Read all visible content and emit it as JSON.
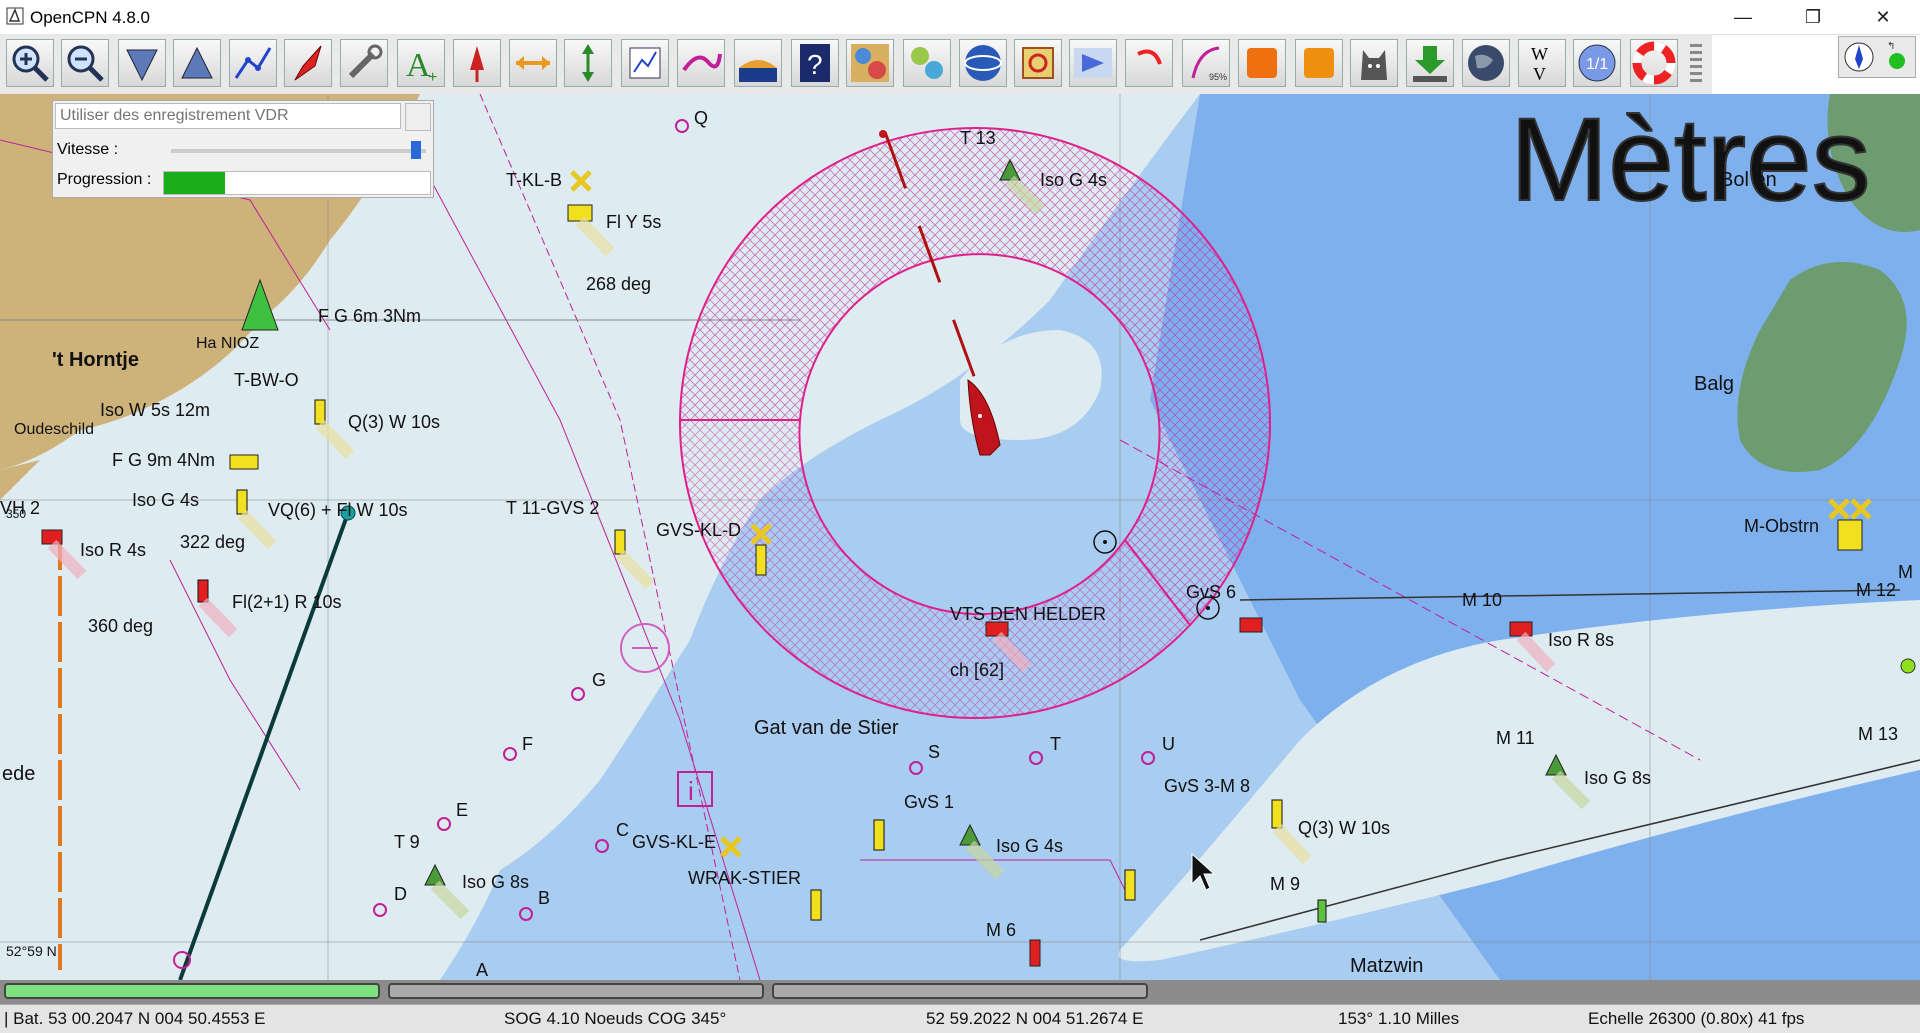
{
  "window": {
    "title": "OpenCPN 4.8.0",
    "minimize": "—",
    "maximize": "❐",
    "close": "✕"
  },
  "toolbar": {
    "tools": [
      {
        "name": "zoom-in",
        "icon": "zoom-in-icon"
      },
      {
        "name": "zoom-out",
        "icon": "zoom-out-icon"
      },
      {
        "name": "scale-down",
        "icon": "scale-down-icon"
      },
      {
        "name": "scale-up",
        "icon": "scale-up-icon"
      },
      {
        "name": "route",
        "icon": "route-icon"
      },
      {
        "name": "auto-follow",
        "icon": "ship-icon"
      },
      {
        "name": "settings",
        "icon": "wrench-icon"
      },
      {
        "name": "text",
        "icon": "text-icon"
      },
      {
        "name": "current",
        "icon": "current-icon"
      },
      {
        "name": "tide",
        "icon": "tide-icon"
      },
      {
        "name": "measure",
        "icon": "measure-icon"
      },
      {
        "name": "route-manager",
        "icon": "route-manager-icon"
      },
      {
        "name": "track",
        "icon": "track-icon"
      },
      {
        "name": "color-scheme",
        "icon": "color-scheme-icon"
      },
      {
        "name": "help",
        "icon": "help-icon"
      },
      {
        "name": "grib",
        "icon": "grib-icon"
      },
      {
        "name": "dashboard",
        "icon": "dashboard-icon"
      },
      {
        "name": "google-earth",
        "icon": "globe-icon"
      },
      {
        "name": "logbook",
        "icon": "logbook-icon"
      },
      {
        "name": "vdr",
        "icon": "vdr-icon"
      },
      {
        "name": "rotate",
        "icon": "rotate-icon"
      },
      {
        "name": "weatherfax",
        "icon": "weatherfax-icon"
      },
      {
        "name": "orange-1",
        "icon": "orange-icon"
      },
      {
        "name": "orange-2",
        "icon": "orange-icon"
      },
      {
        "name": "watchdog",
        "icon": "husky-icon"
      },
      {
        "name": "download",
        "icon": "download-icon"
      },
      {
        "name": "world",
        "icon": "world-icon"
      },
      {
        "name": "wmm",
        "icon": "wmm-icon",
        "text": "W\nV"
      },
      {
        "name": "one-to-one",
        "icon": "one-to-one-icon",
        "text": "1/1"
      },
      {
        "name": "man-overboard",
        "icon": "lifebuoy-icon"
      }
    ]
  },
  "colors": {
    "land": "#cdb27a",
    "shallow": "#deebf0",
    "mid": "#a9ccf1",
    "deep": "#8bb8f0",
    "green_area": "#6c9c70",
    "magenta": "#c02098",
    "own_ship": "#c0141c"
  },
  "vdr": {
    "placeholder": "Utiliser des enregistrement VDR",
    "speed_label": "Vitesse :",
    "progress_label": "Progression :",
    "speed_value": 0.96,
    "progress_value": 0.23
  },
  "chart": {
    "units_watermark": "Mètres",
    "labels": {
      "horntje": "'t Horntje",
      "t13": "T 13",
      "iso_g_4s_top": "Iso G 4s",
      "tklb": "T-KL-B",
      "fly5s": "Fl Y 5s",
      "deg268": "268 deg",
      "fg6m": "F G 6m 3Nm",
      "tbwo": "T-BW-O",
      "isow5s": "Iso W 5s 12m",
      "q3w10s_left": "Q(3) W 10s",
      "fg9m": "F G 9m 4Nm",
      "iso_g_4s_left": "Iso G 4s",
      "vq6": "VQ(6) + Fl W 10s",
      "t11": "T 11-GVS 2",
      "gvskld": "GVS-KL-D",
      "isor4s": "Iso R 4s",
      "deg322": "322 deg",
      "fl21": "Fl(2+1) R 10s",
      "deg360": "360 deg",
      "vts": "VTS DEN HELDER",
      "ch62": "ch [62]",
      "gvs6": "GvS 6",
      "m10": "M 10",
      "isor8s": "Iso R 8s",
      "mobstr": "M-Obstrn",
      "m12": "M 12",
      "m_edge": "M",
      "balg": "Balg",
      "bolen": "Bol en",
      "q": "Q",
      "g": "G",
      "f": "F",
      "e": "E",
      "t9": "T 9",
      "d": "D",
      "iso_g_8s_left": "Iso G 8s",
      "b": "B",
      "a": "A",
      "c": "C",
      "gvskle": "GVS-KL-E",
      "wrak": "WRAK-STIER",
      "gat": "Gat van de Stier",
      "s": "S",
      "t": "T",
      "u": "U",
      "gvs1": "GvS 1",
      "iso_g_4s_mid": "Iso G 4s",
      "gvs3m8": "GvS 3-M 8",
      "q3w10s_right": "Q(3) W 10s",
      "m9": "M 9",
      "m6": "M 6",
      "m11": "M 11",
      "iso_g_8s_right": "Iso G 8s",
      "m13": "M 13",
      "matzwin": "Matzwin",
      "ede": "ede",
      "vh2": "VH 2",
      "lat5259": "52°59 N",
      "oudeschild": "Oudeschild",
      "hnioz": "Ha  NIOZ",
      "zero350": "350"
    }
  },
  "status": {
    "boat_pos": "| Bat. 53 00.2047 N   004 50.4553 E",
    "sog_cog": "SOG 4.10 Noeuds  COG 345°",
    "cursor_pos": "52 59.2022 N   004 51.2674 E",
    "bearing_dist": "153°  1.10 Milles",
    "scale_fps": "Echelle 26300 (0.80x)   41 fps"
  }
}
